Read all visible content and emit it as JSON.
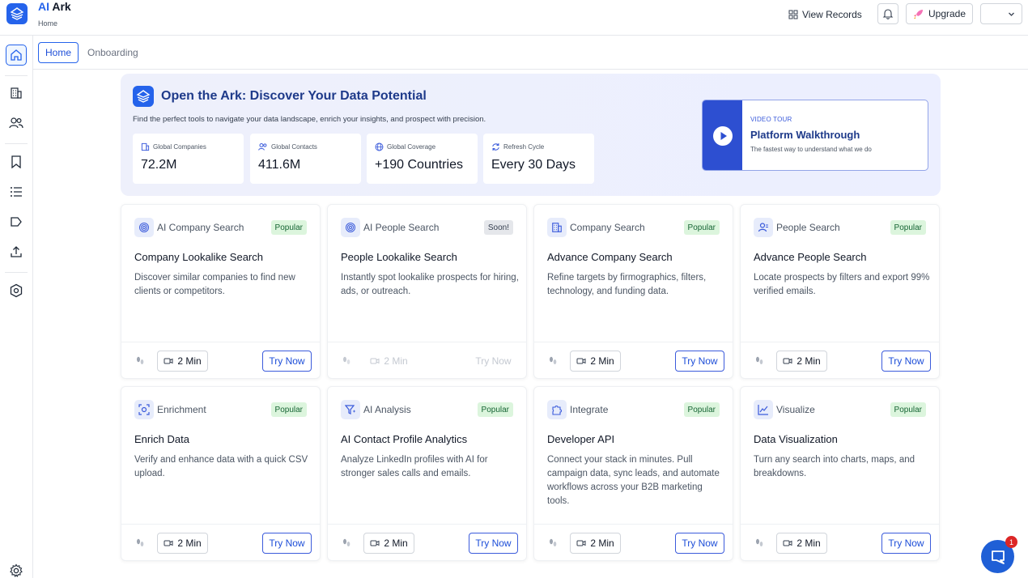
{
  "header": {
    "brand_ai": "AI",
    "brand_rest": " Ark",
    "breadcrumb": "Home",
    "view_records": "View Records",
    "upgrade": "Upgrade"
  },
  "tabs": [
    {
      "label": "Home"
    },
    {
      "label": "Onboarding"
    }
  ],
  "hero": {
    "title": "Open the Ark: Discover Your Data Potential",
    "subtitle": "Find the perfect tools to navigate your data landscape, enrich your insights, and prospect with precision.",
    "stats": [
      {
        "label": "Global Companies",
        "value": "72.2M",
        "icon": "building-icon"
      },
      {
        "label": "Global Contacts",
        "value": "411.6M",
        "icon": "users-icon"
      },
      {
        "label": "Global Coverage",
        "value": "+190 Countries",
        "icon": "globe-icon"
      },
      {
        "label": "Refresh Cycle",
        "value": "Every 30 Days",
        "icon": "refresh-icon"
      }
    ],
    "video": {
      "kicker": "VIDEO TOUR",
      "title": "Platform Walkthrough",
      "desc": "The fastest way to understand what we do"
    }
  },
  "cards": [
    {
      "category": "AI Company Search",
      "badge": "Popular",
      "title": "Company Lookalike Search",
      "desc": "Discover similar companies to find new clients or competitors.",
      "duration": "2 Min",
      "cta": "Try Now"
    },
    {
      "category": "AI People Search",
      "badge": "Soon!",
      "title": "People Lookalike Search",
      "desc": "Instantly spot lookalike prospects for hiring, ads, or outreach.",
      "duration": "2 Min",
      "cta": "Try Now"
    },
    {
      "category": "Company Search",
      "badge": "Popular",
      "title": "Advance Company Search",
      "desc": "Refine targets by firmographics, filters, technology, and funding data.",
      "duration": "2 Min",
      "cta": "Try Now"
    },
    {
      "category": "People Search",
      "badge": "Popular",
      "title": "Advance People Search",
      "desc": "Locate prospects by filters and export 99% verified emails.",
      "duration": "2 Min",
      "cta": "Try Now"
    },
    {
      "category": "Enrichment",
      "badge": "Popular",
      "title": "Enrich Data",
      "desc": "Verify and enhance data with a quick CSV upload.",
      "duration": "2 Min",
      "cta": "Try Now"
    },
    {
      "category": "AI Analysis",
      "badge": "Popular",
      "title": "AI Contact Profile Analytics",
      "desc": "Analyze LinkedIn profiles with AI for stronger sales calls and emails.",
      "duration": "2 Min",
      "cta": "Try Now"
    },
    {
      "category": "Integrate",
      "badge": "Popular",
      "title": "Developer API",
      "desc": "Connect your stack in minutes. Pull campaign data, sync leads, and automate workflows across your B2B marketing tools.",
      "duration": "2 Min",
      "cta": "Try Now"
    },
    {
      "category": "Visualize",
      "badge": "Popular",
      "title": "Data Visualization",
      "desc": "Turn any search into charts, maps, and breakdowns.",
      "duration": "2 Min",
      "cta": "Try Now"
    }
  ],
  "chat": {
    "badge": "1"
  },
  "colors": {
    "accent": "#2563eb",
    "popular_bg": "#dcf5dd",
    "popular_text": "#166534",
    "hero_bg": "#eef0fb"
  }
}
